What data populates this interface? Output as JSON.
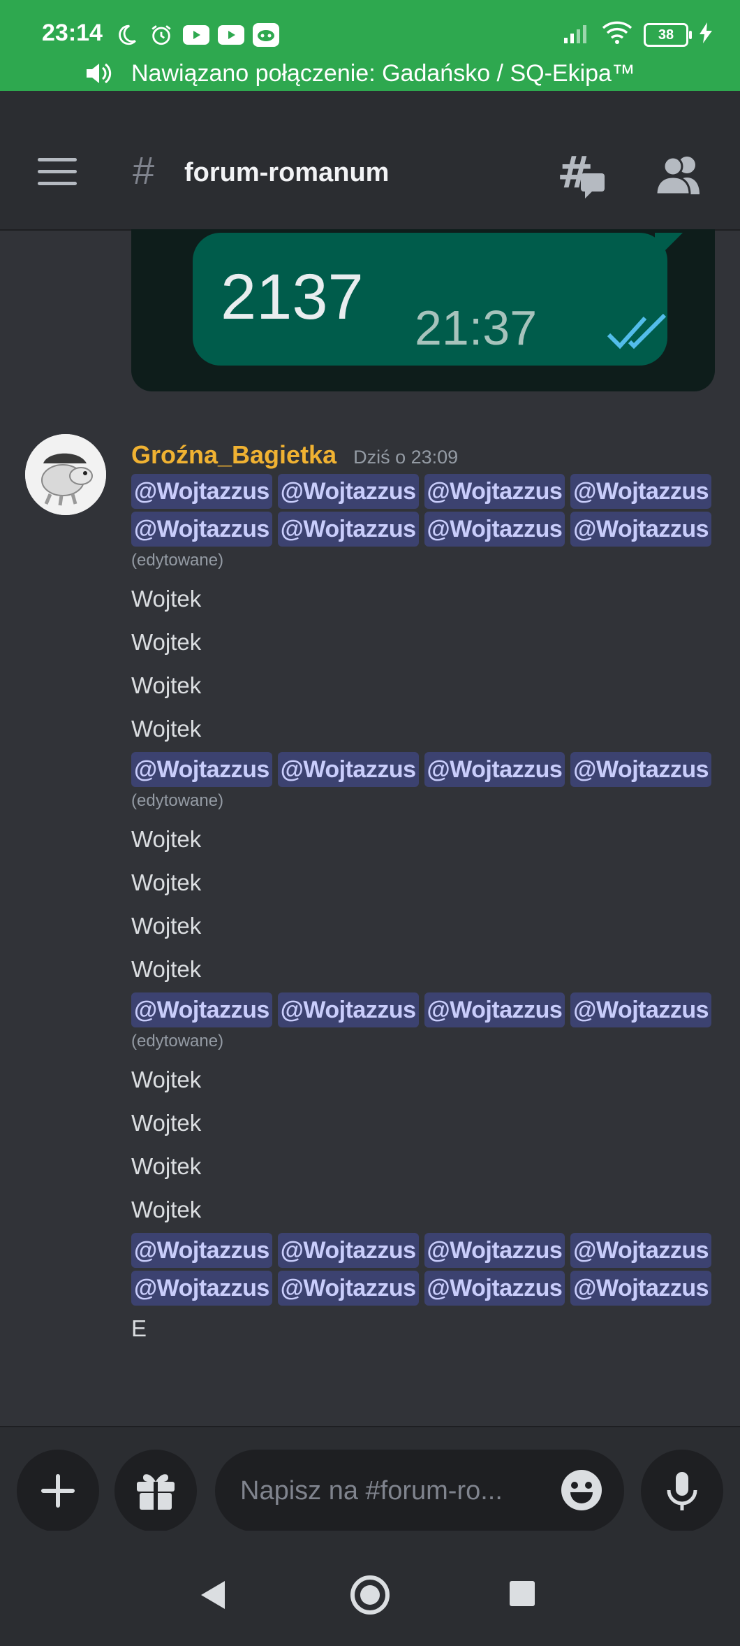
{
  "status_bar": {
    "time": "23:14",
    "battery": "38",
    "call_text": "Nawiązano połączenie: Gadańsko / SQ-Ekipa™"
  },
  "header": {
    "channel_name": "forum-romanum"
  },
  "attachment": {
    "number": "2137",
    "time": "21:37"
  },
  "message": {
    "author": "Groźna_Bagietka",
    "timestamp": "Dziś o 23:09",
    "mention": "@Wojtazzus",
    "edited": "(edytowane)",
    "word": "Wojtek",
    "last": "E"
  },
  "composer": {
    "placeholder": "Napisz na #forum-ro..."
  },
  "colors": {
    "status_green": "#2ea84f",
    "author_color": "#f0b232",
    "mention_bg": "#3c4270"
  }
}
